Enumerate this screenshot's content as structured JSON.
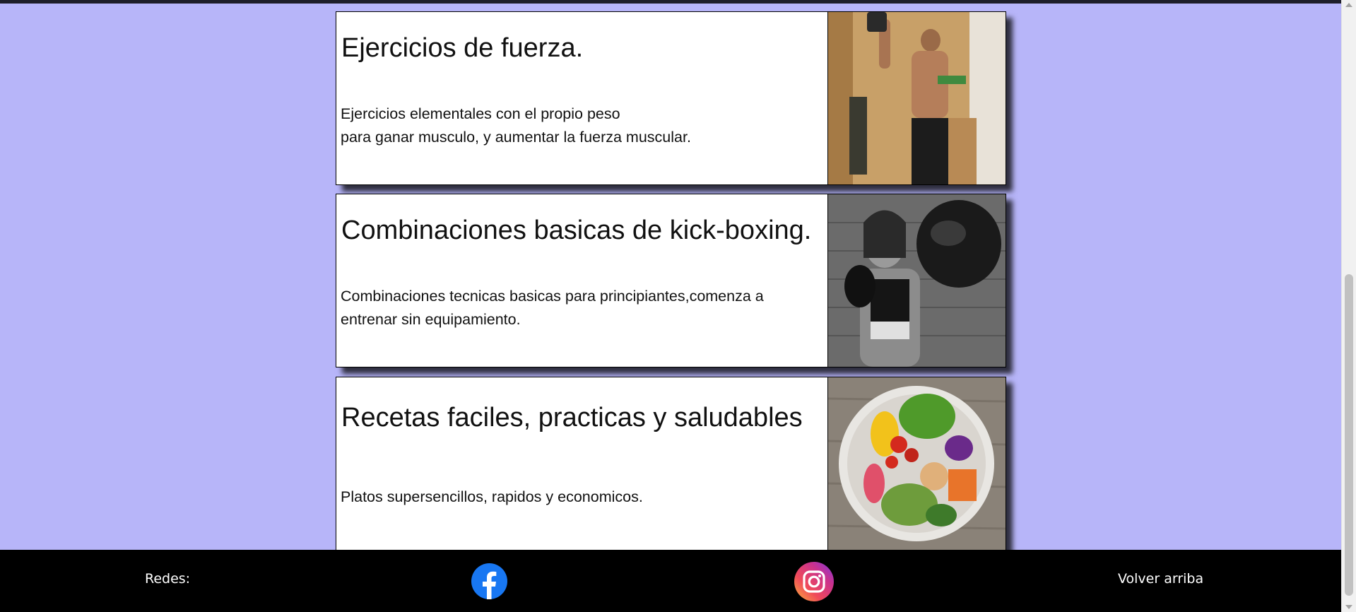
{
  "cards": [
    {
      "title": "Ejercicios de fuerza.",
      "line1": "Ejercicios elementales con el propio peso",
      "line2": "para ganar musculo, y aumentar la fuerza muscular.",
      "image": "strength-training-photo"
    },
    {
      "title": "Combinaciones basicas de kick-boxing.",
      "desc": "Combinaciones tecnicas basicas para principiantes,comenza a entrenar sin equipamiento.",
      "image": "kickboxing-photo"
    },
    {
      "title": "Recetas faciles, practicas y saludables",
      "desc": "Platos supersencillos, rapidos y economicos.",
      "image": "healthy-food-bowl-photo"
    }
  ],
  "footer": {
    "label": "Redes:",
    "facebook_icon": "facebook-icon",
    "instagram_icon": "instagram-icon",
    "back_to_top": "Volver arriba"
  },
  "colors": {
    "page_background": "#b7b5f9",
    "footer_background": "#000000",
    "card_background": "#ffffff",
    "facebook_blue": "#1877f2"
  }
}
